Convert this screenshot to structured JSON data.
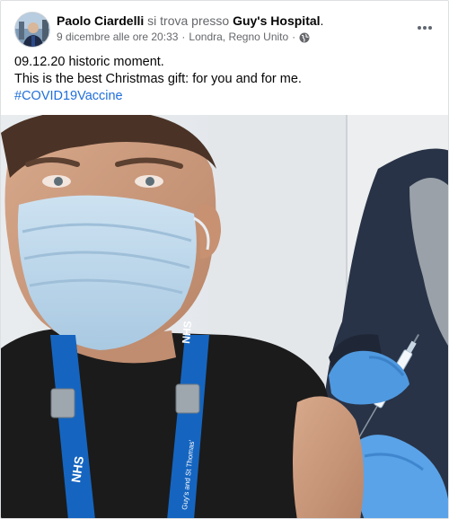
{
  "post": {
    "author": "Paolo Ciardelli",
    "checkin_text": "si trova presso",
    "place": "Guy's Hospital",
    "place_suffix": ".",
    "timestamp": "9 dicembre alle ore 20:33",
    "separator": "·",
    "location": "Londra, Regno Unito",
    "separator2": "·",
    "audience_icon": "globe-icon",
    "more_icon": "more-options-icon",
    "text_line1": "09.12.20 historic moment.",
    "text_line2": "This is the best Christmas gift: for you and for me.",
    "hashtag": "#COVID19Vaccine",
    "photo_label": "NHS",
    "lanyard_text": "Guy's and St Thomas'"
  },
  "colors": {
    "link": "#216fdb",
    "meta": "#65676b",
    "lanyard": "#1565c0",
    "mask": "#bcd6ea",
    "glove": "#5aa3e8"
  }
}
